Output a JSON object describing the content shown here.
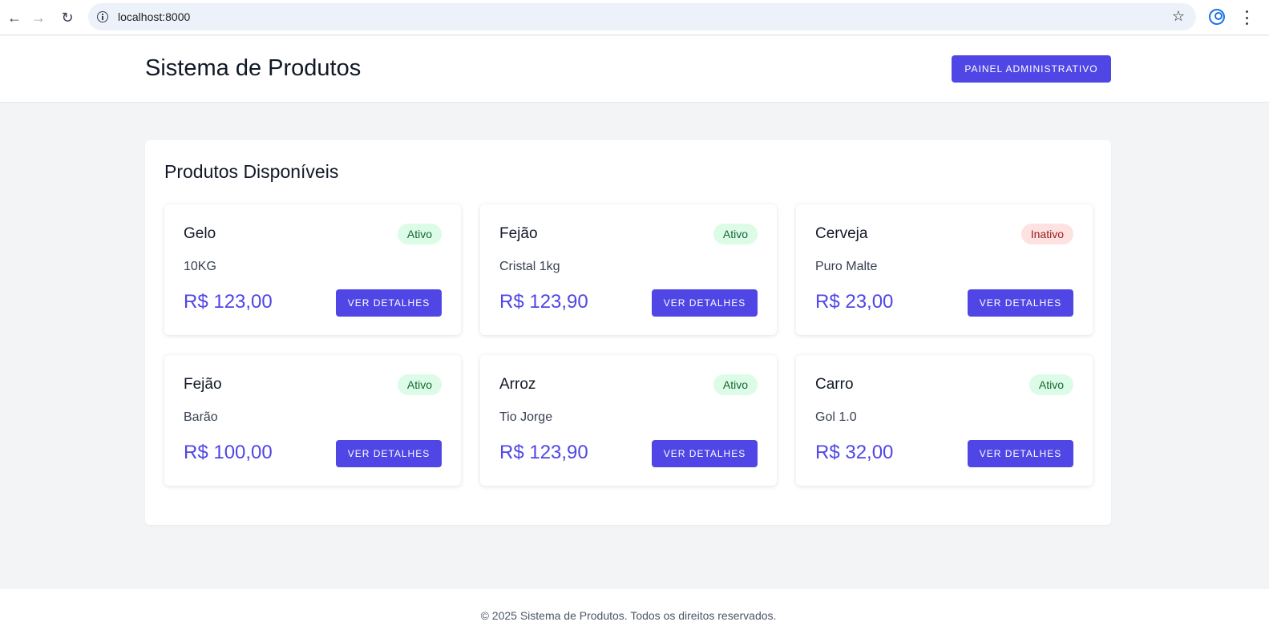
{
  "browser": {
    "url": "localhost:8000"
  },
  "header": {
    "title": "Sistema de Produtos",
    "admin_button_label": "PAINEL ADMINISTRATIVO"
  },
  "main": {
    "section_title": "Produtos Disponíveis",
    "products": [
      {
        "name": "Gelo",
        "status": "Ativo",
        "description": "10KG",
        "price": "R$ 123,00",
        "button_label": "VER DETALHES"
      },
      {
        "name": "Fejão",
        "status": "Ativo",
        "description": "Cristal 1kg",
        "price": "R$ 123,90",
        "button_label": "VER DETALHES"
      },
      {
        "name": "Cerveja",
        "status": "Inativo",
        "description": "Puro Malte",
        "price": "R$ 23,00",
        "button_label": "VER DETALHES"
      },
      {
        "name": "Fejão",
        "status": "Ativo",
        "description": "Barão",
        "price": "R$ 100,00",
        "button_label": "VER DETALHES"
      },
      {
        "name": "Arroz",
        "status": "Ativo",
        "description": "Tio Jorge",
        "price": "R$ 123,90",
        "button_label": "VER DETALHES"
      },
      {
        "name": "Carro",
        "status": "Ativo",
        "description": "Gol 1.0",
        "price": "R$ 32,00",
        "button_label": "VER DETALHES"
      }
    ]
  },
  "footer": {
    "text": "© 2025 Sistema de Produtos. Todos os direitos reservados."
  },
  "colors": {
    "accent": "#4f46e5",
    "active_badge_bg": "#dcfce7",
    "inactive_badge_bg": "#fee2e2",
    "page_bg": "#f3f4f6"
  }
}
